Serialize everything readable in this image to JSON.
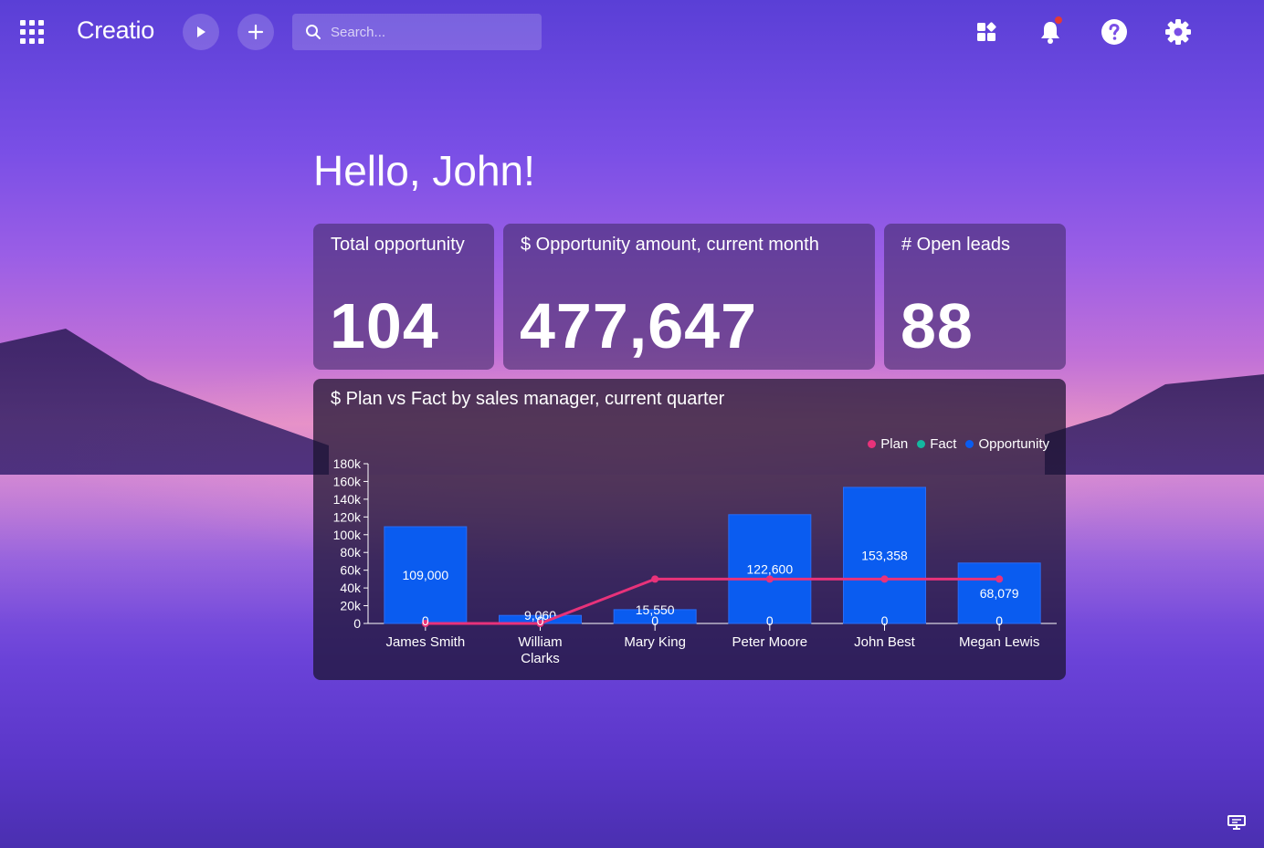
{
  "app": {
    "logo_text": "Creatio"
  },
  "search": {
    "placeholder": "Search..."
  },
  "icons": {
    "apps": "apps-grid-icon",
    "run": "play-icon",
    "add": "plus-icon",
    "search": "search-icon",
    "widgets": "widgets-icon",
    "notifications": "bell-icon",
    "help": "help-icon",
    "settings": "gear-icon",
    "footer": "monitor-icon"
  },
  "colors": {
    "plan": "#e8327a",
    "fact": "#14b8a0",
    "opportunity": "#0a5cf0"
  },
  "greeting": "Hello, John!",
  "metrics": [
    {
      "title": "Total opportunity",
      "value": "104"
    },
    {
      "title": "$ Opportunity amount, current month",
      "value": "477,647"
    },
    {
      "title": "# Open leads",
      "value": "88"
    }
  ],
  "chart_panel": {
    "title": "$ Plan vs Fact by sales manager, current quarter"
  },
  "chart_data": {
    "type": "bar",
    "title": "$ Plan vs Fact by sales manager, current quarter",
    "categories": [
      "James Smith",
      "William Clarks",
      "Mary King",
      "Peter Moore",
      "John Best",
      "Megan Lewis"
    ],
    "series": [
      {
        "name": "Plan",
        "type": "line",
        "values": [
          0,
          0,
          50000,
          50000,
          50000,
          50000
        ]
      },
      {
        "name": "Fact",
        "type": "bar",
        "values": [
          0,
          0,
          0,
          0,
          0,
          0
        ]
      },
      {
        "name": "Opportunity",
        "type": "bar",
        "values": [
          109000,
          9060,
          15550,
          122600,
          153358,
          68079
        ]
      }
    ],
    "bar_labels": [
      "109,000",
      "9,060",
      "15,550",
      "122,600",
      "153,358",
      "68,079"
    ],
    "fact_labels": [
      "0",
      "0",
      "0",
      "0",
      "0",
      "0"
    ],
    "yticks": [
      0,
      20000,
      40000,
      60000,
      80000,
      100000,
      120000,
      140000,
      160000,
      180000
    ],
    "ytick_labels": [
      "0",
      "20k",
      "40k",
      "60k",
      "80k",
      "100k",
      "120k",
      "140k",
      "160k",
      "180k"
    ],
    "ylim": [
      0,
      180000
    ],
    "legend": "top-right",
    "grid": false
  }
}
